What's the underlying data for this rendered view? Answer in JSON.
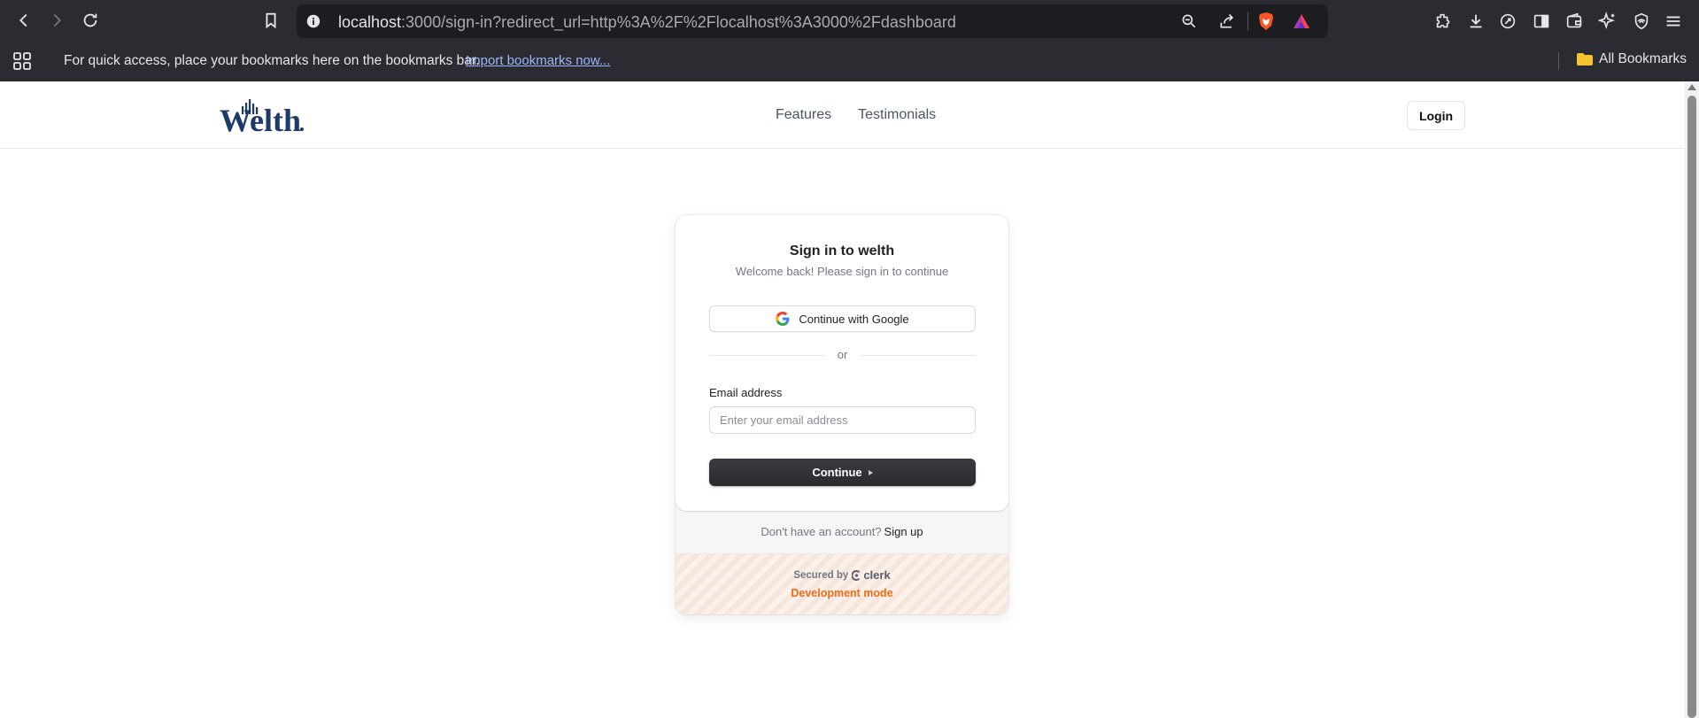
{
  "browser": {
    "url_host": "localhost",
    "url_rest": ":3000/sign-in?redirect_url=http%3A%2F%2Flocalhost%3A3000%2Fdashboard",
    "bookmarks_prompt": "For quick access, place your bookmarks here on the bookmarks bar.",
    "import_link": "Import bookmarks now...",
    "all_bookmarks": "All Bookmarks"
  },
  "site": {
    "brand": "Welth",
    "nav": [
      "Features",
      "Testimonials"
    ],
    "login_label": "Login"
  },
  "signin": {
    "title": "Sign in to welth",
    "subtitle": "Welcome back! Please sign in to continue",
    "google_label": "Continue with Google",
    "divider": "or",
    "email_label": "Email address",
    "email_placeholder": "Enter your email address",
    "email_value": "",
    "continue_label": "Continue",
    "no_account": "Don't have an account?",
    "signup_link": "Sign up",
    "secured_by": "Secured by",
    "clerk": "clerk",
    "dev_mode": "Development mode"
  },
  "colors": {
    "chrome_bg": "#2b2c31",
    "brand_navy": "#1e3a6b",
    "dev_orange": "#f36b16"
  }
}
